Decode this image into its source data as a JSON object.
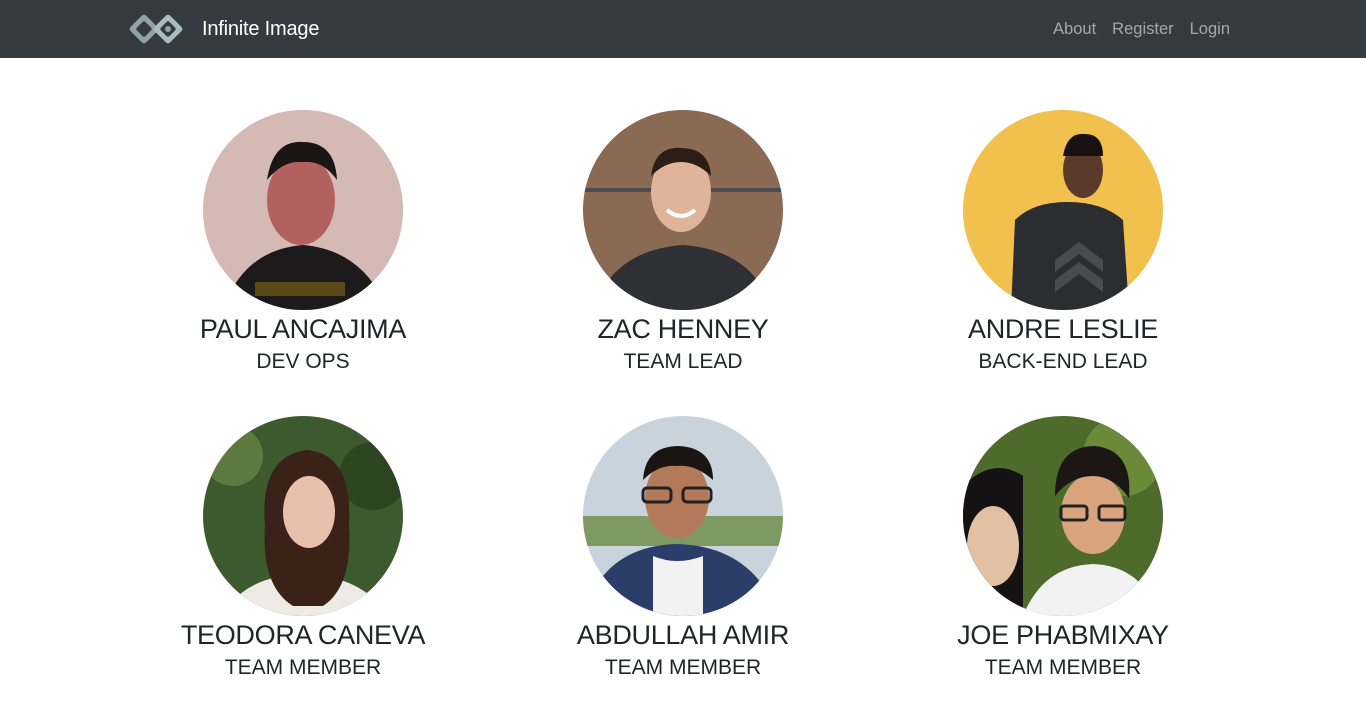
{
  "navbar": {
    "brand": "Infinite Image",
    "logo_icon": "infinity-logo-icon",
    "links": [
      {
        "label": "About"
      },
      {
        "label": "Register"
      },
      {
        "label": "Login"
      }
    ]
  },
  "team": [
    {
      "name": "PAUL ANCAJIMA",
      "role": "DEV OPS",
      "photo": "portrait-photo",
      "bg": "#c9a9a6"
    },
    {
      "name": "ZAC HENNEY",
      "role": "TEAM LEAD",
      "photo": "portrait-photo",
      "bg": "#8a6a52"
    },
    {
      "name": "ANDRE LESLIE",
      "role": "BACK-END LEAD",
      "photo": "portrait-photo",
      "bg": "#f2c04c"
    },
    {
      "name": "TEODORA CANEVA",
      "role": "TEAM MEMBER",
      "photo": "portrait-photo",
      "bg": "#3d5a2f"
    },
    {
      "name": "ABDULLAH AMIR",
      "role": "TEAM MEMBER",
      "photo": "portrait-photo",
      "bg": "#9fb0c4"
    },
    {
      "name": "JOE PHABMIXAY",
      "role": "TEAM MEMBER",
      "photo": "portrait-photo",
      "bg": "#4e6b2c"
    }
  ],
  "colors": {
    "navbar_bg": "#343a40",
    "nav_link": "rgba(255,255,255,0.55)",
    "text": "#212529"
  }
}
